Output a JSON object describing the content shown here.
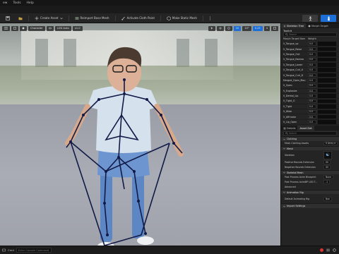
{
  "menu": [
    "ew",
    "Tools",
    "Help"
  ],
  "toolbar": {
    "buttons": [
      "Create Asset",
      "Reimport Base Mesh",
      "Activate Cloth Paint",
      "Make Static Mesh"
    ]
  },
  "viewport": {
    "chips": [
      "Character",
      "LOD Auto",
      "x1.0"
    ],
    "chips_right": [
      "10",
      "10°",
      "0.25",
      "4"
    ]
  },
  "statusbar": {
    "cmd": "Cmd",
    "input_placeholder": "Enter Console Command"
  },
  "skeleton_panel": {
    "tabs": [
      "Skeleton Tree",
      "Morph Target"
    ],
    "title": "Toolkit",
    "search_placeholder": "Search",
    "col_name": "Morph Target Nam",
    "col_weight": "Weight",
    "rows": [
      {
        "name": "V_Tongue_up",
        "value": "0.0"
      },
      {
        "name": "V_Tongue_Raise",
        "value": "0.0"
      },
      {
        "name": "V_Tongue_Out",
        "value": "0.0"
      },
      {
        "name": "V_Tongue_Narrow",
        "value": "0.0"
      },
      {
        "name": "V_Tongue_Lower",
        "value": "0.0"
      },
      {
        "name": "V_Tongue_Curl_U",
        "value": "0.0"
      },
      {
        "name": "V_Tongue_Curl_D",
        "value": "0.0"
      },
      {
        "name": "Merged_Open_Mou",
        "value": "0.0"
      },
      {
        "name": "V_Open",
        "value": "0.0"
      },
      {
        "name": "V_Explosive",
        "value": "0.0"
      },
      {
        "name": "V_Dental_Lip",
        "value": "0.0"
      },
      {
        "name": "V_Tight_O",
        "value": "0.0"
      },
      {
        "name": "V_Tight",
        "value": "0.0"
      },
      {
        "name": "V_Wide",
        "value": "0.0"
      },
      {
        "name": "V_Affricate",
        "value": "0.0"
      },
      {
        "name": "V_Lip_Open",
        "value": "0.0"
      }
    ]
  },
  "details_panel": {
    "tabs": [
      "Details",
      "Asset Det"
    ],
    "search_placeholder": "Search",
    "sections": [
      {
        "title": "Clothing",
        "rows": [
          {
            "label": "Mesh Clothing Assets",
            "value": "0 Array e"
          }
        ]
      },
      {
        "title": "Mesh",
        "rows": [
          {
            "label": "Skeleton",
            "value": ""
          },
          {
            "label": "Positive Bounds Extension",
            "value": "X0"
          },
          {
            "label": "Negative Bounds Extension",
            "value": "X0"
          }
        ]
      },
      {
        "title": "Skeletal Mesh",
        "rows": [
          {
            "label": "Post Process Anim Blueprint",
            "value": "None"
          },
          {
            "label": "Post Process AnimBP LOD T...",
            "value": "-1"
          },
          {
            "label": "Advanced",
            "value": ""
          }
        ]
      },
      {
        "title": "Animation Rig",
        "rows": [
          {
            "label": "Default Animating Rig",
            "value": "Non"
          }
        ]
      },
      {
        "title": "Import Settings",
        "rows": []
      }
    ]
  },
  "colors": {
    "accent": "#1c6fd6",
    "skeleton": "#121a48"
  }
}
